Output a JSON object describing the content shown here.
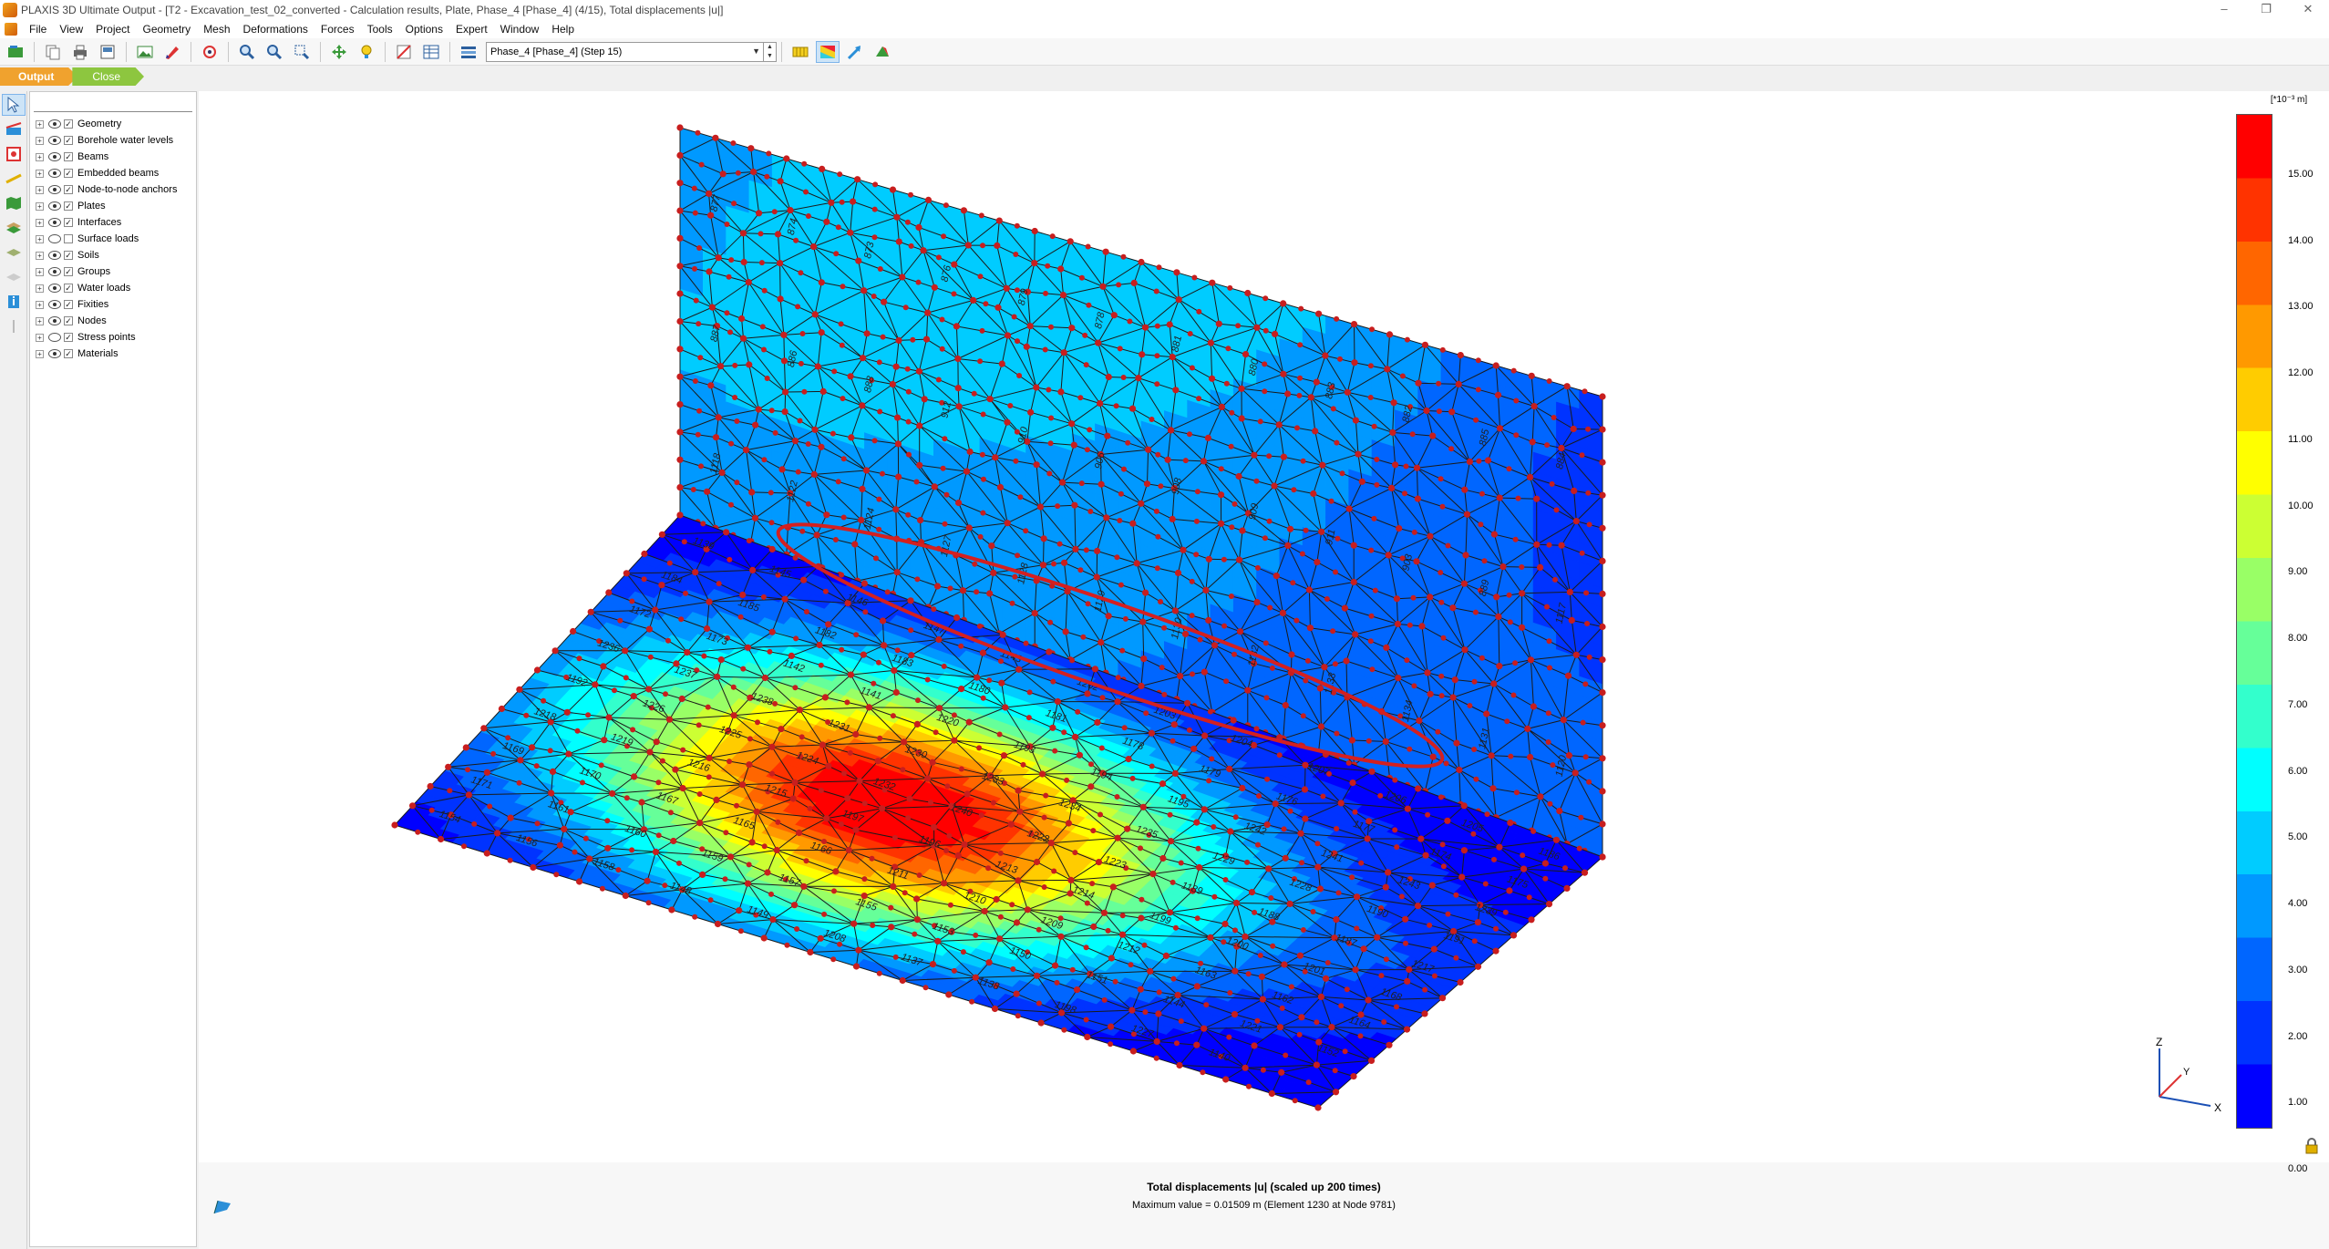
{
  "window": {
    "title": "PLAXIS 3D Ultimate Output - [T2 - Excavation_test_02_converted - Calculation results, Plate, Phase_4 [Phase_4] (4/15), Total displacements |u|]",
    "controls": [
      "–",
      "❐",
      "✕"
    ]
  },
  "menu": [
    "File",
    "View",
    "Project",
    "Geometry",
    "Mesh",
    "Deformations",
    "Forces",
    "Tools",
    "Options",
    "Expert",
    "Window",
    "Help"
  ],
  "toolbar": {
    "phase_select": "Phase_4 [Phase_4] (Step 15)"
  },
  "tabs": {
    "output": "Output",
    "close": "Close"
  },
  "explorer": {
    "items": [
      {
        "label": "Geometry",
        "eye": true,
        "checked": true
      },
      {
        "label": "Borehole water levels",
        "eye": true,
        "checked": true
      },
      {
        "label": "Beams",
        "eye": true,
        "checked": true
      },
      {
        "label": "Embedded beams",
        "eye": true,
        "checked": true
      },
      {
        "label": "Node-to-node anchors",
        "eye": true,
        "checked": true
      },
      {
        "label": "Plates",
        "eye": true,
        "checked": true
      },
      {
        "label": "Interfaces",
        "eye": true,
        "checked": true
      },
      {
        "label": "Surface loads",
        "eye": false,
        "checked": false
      },
      {
        "label": "Soils",
        "eye": true,
        "checked": true
      },
      {
        "label": "Groups",
        "eye": true,
        "checked": true
      },
      {
        "label": "Water loads",
        "eye": true,
        "checked": true
      },
      {
        "label": "Fixities",
        "eye": true,
        "checked": true
      },
      {
        "label": "Nodes",
        "eye": true,
        "checked": true
      },
      {
        "label": "Stress points",
        "eye": false,
        "checked": true
      },
      {
        "label": "Materials",
        "eye": true,
        "checked": true
      }
    ]
  },
  "viewport": {
    "caption": "Total displacements |u| (scaled up 200 times)",
    "max_value": "Maximum value = 0.01509 m (Element 1230 at Node 9781)",
    "element_labels_wall": [
      "877",
      "874",
      "873",
      "876",
      "879",
      "878",
      "881",
      "880",
      "883",
      "882",
      "885",
      "884",
      "887",
      "886",
      "888",
      "912",
      "910",
      "906",
      "908",
      "909",
      "911",
      "903",
      "889",
      "1117",
      "1118",
      "1122",
      "1124",
      "1127",
      "1128",
      "1129",
      "1130",
      "1132",
      "1133",
      "1134",
      "1131",
      "1120"
    ],
    "element_labels_base": [
      "1139",
      "1145",
      "1146",
      "1147",
      "1143",
      "1202",
      "1203",
      "1204",
      "1207",
      "1206",
      "1205",
      "1186",
      "1184",
      "1185",
      "1182",
      "1183",
      "1180",
      "1181",
      "1178",
      "1179",
      "1176",
      "1177",
      "1174",
      "1175",
      "1172",
      "1173",
      "1142",
      "1141",
      "1220",
      "1193",
      "1194",
      "1195",
      "1242",
      "1241",
      "1243",
      "1239",
      "1236",
      "1237",
      "1238",
      "1231",
      "1230",
      "1233",
      "1234",
      "1235",
      "1229",
      "1228",
      "1190",
      "1191",
      "1192",
      "1226",
      "1225",
      "1224",
      "1232",
      "1240",
      "1222",
      "1223",
      "1189",
      "1188",
      "1187",
      "1217",
      "1218",
      "1219",
      "1216",
      "1215",
      "1197",
      "1196",
      "1213",
      "1214",
      "1199",
      "1200",
      "1201",
      "1168",
      "1169",
      "1170",
      "1167",
      "1165",
      "1166",
      "1211",
      "1210",
      "1209",
      "1212",
      "1163",
      "1162",
      "1164",
      "1171",
      "1161",
      "1160",
      "1159",
      "1157",
      "1155",
      "1153",
      "1150",
      "1151",
      "1144",
      "1221",
      "1152",
      "1154",
      "1156",
      "1158",
      "1148",
      "1149",
      "1208",
      "1137",
      "1138",
      "1198",
      "1227",
      "1140"
    ]
  },
  "legend": {
    "unit": "[*10⁻³ m]",
    "labels": [
      "15.00",
      "14.00",
      "13.00",
      "12.00",
      "11.00",
      "10.00",
      "9.00",
      "8.00",
      "7.00",
      "6.00",
      "5.00",
      "4.00",
      "3.00",
      "2.00",
      "1.00",
      "0.00"
    ],
    "colors": [
      "#ff0000",
      "#ff3300",
      "#ff6600",
      "#ff9900",
      "#ffcc00",
      "#ffff00",
      "#ccff33",
      "#99ff66",
      "#66ff99",
      "#33ffcc",
      "#00ffff",
      "#00ccff",
      "#0099ff",
      "#0066ff",
      "#0033ff",
      "#0000ff"
    ]
  },
  "axis": {
    "z": "Z",
    "y": "Y",
    "x": "X"
  }
}
